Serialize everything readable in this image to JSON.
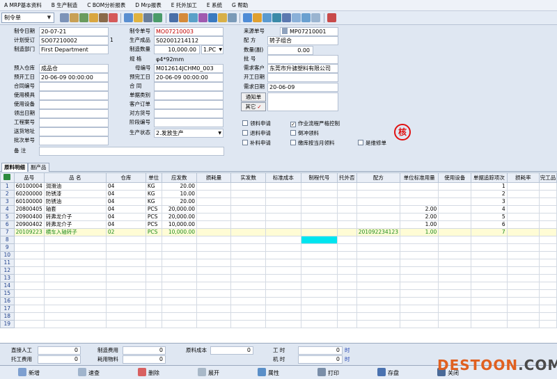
{
  "menu": [
    "A MRP基本资料",
    "B 生产制造",
    "C BOM分析报表",
    "D Mrp报表",
    "E 托外加工",
    "E 系统",
    "G 帮助"
  ],
  "toolbar": {
    "combo_value": "制令单"
  },
  "form": {
    "order_date_label": "制令日期",
    "order_date": "20-07-21",
    "plan_no_label": "计划受订",
    "plan_no": "SO07210002",
    "plan_suffix": "1",
    "dept_label": "制造部门",
    "dept": "First Department",
    "mo_no_label": "制令单号",
    "mo_no": "MO07210003",
    "product_label": "生产成品",
    "product": "S02001214112",
    "qty_label": "制造数量",
    "qty": "10,000.00",
    "unit": "1.PC",
    "spec_label": "规    格",
    "spec": "φ4*92mm",
    "parent_label": "母编号",
    "parent": "M012614JCHM0_003",
    "source_label": "来源单号",
    "source_no": "MP07210001",
    "recipe_label": "配    方",
    "recipe": "转子组合",
    "qty2_label": "数量(副)",
    "qty2": "0.00",
    "batch_label": "批    号",
    "customer_label": "需求客户",
    "customer": "东莞市升骕塑料有限公司",
    "start_label": "开工日期",
    "demand_label": "需求日期",
    "demand_date": "20-06-09",
    "warehouse_label": "预入仓库",
    "warehouse": "成品仓",
    "plan_start_label": "预开工日",
    "plan_start": "20-06-09 00:00:00",
    "plan_end_label": "预完工日",
    "plan_end": "20-06-09 00:00:00",
    "left_labels": [
      "合同编号",
      "使用模具",
      "使用设备",
      "领出日期",
      "工程案号",
      "送货地址",
      "批次单号",
      "备    注"
    ],
    "mid_labels": [
      "合    同",
      "单据类别",
      "客户订单",
      "对方货号",
      "阶段编号"
    ],
    "status_label": "生产状态",
    "status": "2.发放生产",
    "notice_btn": "通知单",
    "other_btn": "其它"
  },
  "checkboxes": [
    {
      "label": "领料申请",
      "checked": false
    },
    {
      "label": "作业流程严格控制",
      "checked": true
    },
    {
      "label": "退料申请",
      "checked": false
    },
    {
      "label": "倒冲领料",
      "checked": false
    },
    {
      "label": "补料申请",
      "checked": false
    },
    {
      "label": "缴库按当月领料",
      "checked": false
    },
    {
      "label": "是维修单",
      "checked": false
    }
  ],
  "stamp": "核",
  "tabs": [
    "原料明细",
    "副产品"
  ],
  "table": {
    "headers": [
      "品号",
      "品 名",
      "仓库",
      "单位",
      "应发数",
      "损耗量",
      "实发数",
      "标准成本",
      "制程代号",
      "托外否",
      "配方",
      "单位标准用量",
      "使用设备",
      "单据追踪项次",
      "损耗率",
      "完工品"
    ],
    "rows": [
      [
        "60100004",
        "润滑油",
        "04",
        "KG",
        "20.00",
        "",
        "",
        "",
        "",
        "",
        "",
        "",
        "",
        "1",
        "",
        ""
      ],
      [
        "60200000",
        "防锈漆",
        "04",
        "KG",
        "10.00",
        "",
        "",
        "",
        "",
        "",
        "",
        "",
        "",
        "2",
        "",
        ""
      ],
      [
        "60100000",
        "防锈油",
        "04",
        "KG",
        "20.00",
        "",
        "",
        "",
        "",
        "",
        "",
        "",
        "",
        "3",
        "",
        ""
      ],
      [
        "20800405",
        "轴套",
        "04",
        "PCS",
        "20,000.00",
        "",
        "",
        "",
        "",
        "",
        "",
        "2.00",
        "",
        "4",
        "",
        ""
      ],
      [
        "20900400",
        "转弗龙介子",
        "04",
        "PCS",
        "20,000.00",
        "",
        "",
        "",
        "",
        "",
        "",
        "2.00",
        "",
        "5",
        "",
        ""
      ],
      [
        "20900402",
        "转弗龙介子",
        "04",
        "PCS",
        "10,000.00",
        "",
        "",
        "",
        "",
        "",
        "",
        "1.00",
        "",
        "6",
        "",
        ""
      ],
      [
        "20109223",
        "横车入轴转子",
        "02",
        "PCS",
        "10,000.00",
        "",
        "",
        "",
        "",
        "",
        "201092234123",
        "1.00",
        "",
        "7",
        "",
        ""
      ]
    ]
  },
  "footer": {
    "direct_labor_label": "直接人工",
    "direct_labor": "0",
    "mfg_cost_label": "制造费用",
    "mfg_cost": "0",
    "material_cost_label": "原料成本",
    "material_cost": "0",
    "work_hours_label": "工    时",
    "work_hours": "0",
    "hours_unit": "时",
    "outsource_label": "托工费用",
    "outsource": "0",
    "consumables_label": "耗用物料",
    "consumables": "0",
    "machine_label": "机    时",
    "machine_hours": "0",
    "machine_unit": "时"
  },
  "bottom_buttons": [
    "新增",
    "速查",
    "删除",
    "展开",
    "属性",
    "打印",
    "存盘",
    "关闭"
  ],
  "watermark": "DESTOON.COM"
}
